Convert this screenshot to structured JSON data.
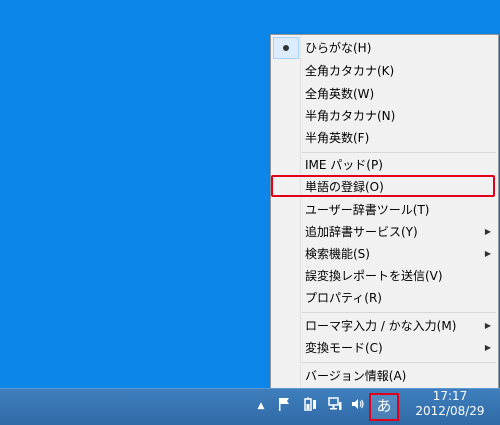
{
  "menu": {
    "items": [
      {
        "label": "ひらがな(H)",
        "checked": true
      },
      {
        "label": "全角カタカナ(K)"
      },
      {
        "label": "全角英数(W)"
      },
      {
        "label": "半角カタカナ(N)"
      },
      {
        "label": "半角英数(F)"
      },
      {
        "label": "IME パッド(P)"
      },
      {
        "label": "単語の登録(O)",
        "highlighted": true
      },
      {
        "label": "ユーザー辞書ツール(T)"
      },
      {
        "label": "追加辞書サービス(Y)",
        "submenu": true
      },
      {
        "label": "検索機能(S)",
        "submenu": true
      },
      {
        "label": "誤変換レポートを送信(V)"
      },
      {
        "label": "プロパティ(R)"
      },
      {
        "label": "ローマ字入力 / かな入力(M)",
        "submenu": true
      },
      {
        "label": "変換モード(C)",
        "submenu": true
      },
      {
        "label": "バージョン情報(A)"
      }
    ],
    "check_mark": "●",
    "arrow_glyph": "▶"
  },
  "taskbar": {
    "show_hidden_icon": "chevron-up-icon",
    "flag_icon": "action-center-flag-icon",
    "power_icon": "power-icon",
    "network_icon": "network-icon",
    "volume_icon": "volume-icon",
    "ime_label": "あ",
    "clock_time": "17:17",
    "clock_date": "2012/08/29"
  },
  "colors": {
    "desktop": "#0c86e8",
    "highlight": "#e0001a",
    "taskbar": "#3574b3"
  }
}
